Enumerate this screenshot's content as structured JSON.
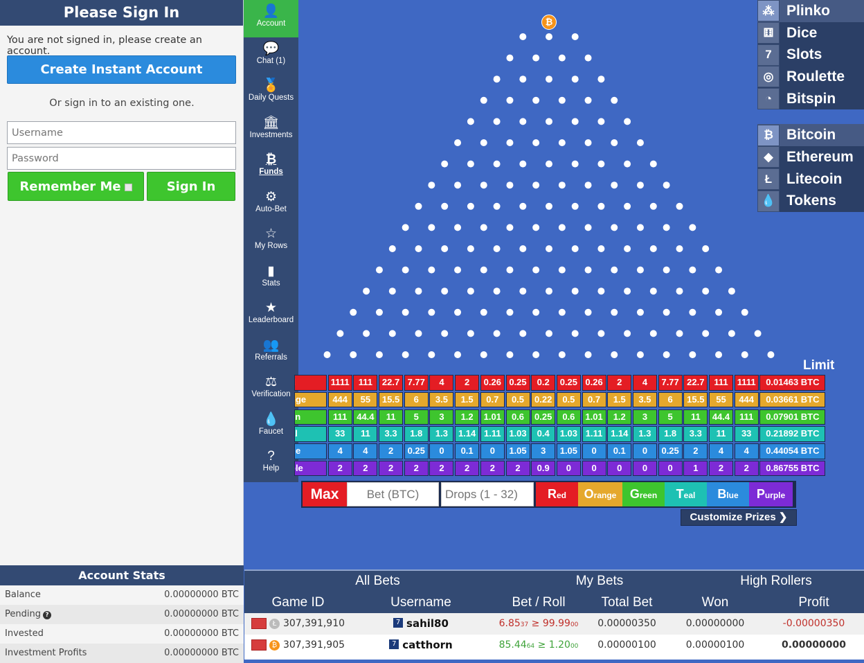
{
  "signin": {
    "title": "Please Sign In",
    "message": "You are not signed in, please create an account.",
    "create_button": "Create Instant Account",
    "or_text": "Or sign in to an existing one.",
    "username_placeholder": "Username",
    "password_placeholder": "Password",
    "remember_label": "Remember Me",
    "signin_button": "Sign In"
  },
  "account_stats": {
    "title": "Account Stats",
    "rows": [
      {
        "label": "Balance",
        "value": "0.00000000 BTC"
      },
      {
        "label": "Pending",
        "value": "0.00000000 BTC"
      },
      {
        "label": "Invested",
        "value": "0.00000000 BTC"
      },
      {
        "label": "Investment Profits",
        "value": "0.00000000 BTC"
      }
    ]
  },
  "nav": [
    {
      "label": "Account",
      "icon": "user-icon",
      "glyph": "👤"
    },
    {
      "label": "Chat (1)",
      "icon": "chat-icon",
      "glyph": "💬"
    },
    {
      "label": "Daily Quests",
      "icon": "award-icon",
      "glyph": "🏅"
    },
    {
      "label": "Investments",
      "icon": "bank-icon",
      "glyph": "🏛"
    },
    {
      "label": "Funds",
      "icon": "bitcoin-icon",
      "glyph": "₿"
    },
    {
      "label": "Auto-Bet",
      "icon": "gear-icon",
      "glyph": "⚙"
    },
    {
      "label": "My Rows",
      "icon": "star-outline-icon",
      "glyph": "☆"
    },
    {
      "label": "Stats",
      "icon": "bar-chart-icon",
      "glyph": "▮"
    },
    {
      "label": "Leaderboard",
      "icon": "star-icon",
      "glyph": "★"
    },
    {
      "label": "Referrals",
      "icon": "users-icon",
      "glyph": "👥"
    },
    {
      "label": "Verification",
      "icon": "scale-icon",
      "glyph": "⚖"
    },
    {
      "label": "Faucet",
      "icon": "droplet-icon",
      "glyph": "💧"
    },
    {
      "label": "Help",
      "icon": "question-icon",
      "glyph": "?"
    }
  ],
  "games": [
    {
      "label": "Plinko",
      "icon": "plinko-icon"
    },
    {
      "label": "Dice",
      "icon": "dice-icon"
    },
    {
      "label": "Slots",
      "icon": "slots-icon"
    },
    {
      "label": "Roulette",
      "icon": "roulette-icon"
    },
    {
      "label": "Bitspin",
      "icon": "bitspin-icon"
    }
  ],
  "currencies": [
    {
      "label": "Bitcoin",
      "icon": "bitcoin-icon"
    },
    {
      "label": "Ethereum",
      "icon": "ethereum-icon"
    },
    {
      "label": "Litecoin",
      "icon": "litecoin-icon"
    },
    {
      "label": "Tokens",
      "icon": "droplet-icon"
    }
  ],
  "limit_label": "Limit",
  "prize_rows": [
    {
      "label": "d",
      "color": "#e41d24",
      "cells": [
        "1111",
        "111",
        "22.7",
        "7.77",
        "4",
        "2",
        "0.26",
        "0.25",
        "0.2",
        "0.25",
        "0.26",
        "2",
        "4",
        "7.77",
        "22.7",
        "111",
        "1111"
      ],
      "limit": "0.01463 BTC"
    },
    {
      "label": "nge",
      "color": "#e5a82c",
      "cells": [
        "444",
        "55",
        "15.5",
        "6",
        "3.5",
        "1.5",
        "0.7",
        "0.5",
        "0.22",
        "0.5",
        "0.7",
        "1.5",
        "3.5",
        "6",
        "15.5",
        "55",
        "444"
      ],
      "limit": "0.03661 BTC"
    },
    {
      "label": "en",
      "color": "#3ec52e",
      "cells": [
        "111",
        "44.4",
        "11",
        "5",
        "3",
        "1.2",
        "1.01",
        "0.6",
        "0.25",
        "0.6",
        "1.01",
        "1.2",
        "3",
        "5",
        "11",
        "44.4",
        "111"
      ],
      "limit": "0.07901 BTC"
    },
    {
      "label": "al",
      "color": "#1ec1b3",
      "cells": [
        "33",
        "11",
        "3.3",
        "1.8",
        "1.3",
        "1.14",
        "1.11",
        "1.03",
        "0.4",
        "1.03",
        "1.11",
        "1.14",
        "1.3",
        "1.8",
        "3.3",
        "11",
        "33"
      ],
      "limit": "0.21892 BTC"
    },
    {
      "label": "ue",
      "color": "#2b8bdd",
      "cells": [
        "4",
        "4",
        "2",
        "0.25",
        "0",
        "0.1",
        "0",
        "1.05",
        "3",
        "1.05",
        "0",
        "0.1",
        "0",
        "0.25",
        "2",
        "4",
        "4"
      ],
      "limit": "0.44054 BTC"
    },
    {
      "label": "ple",
      "color": "#7d2bd6",
      "cells": [
        "2",
        "2",
        "2",
        "2",
        "2",
        "2",
        "2",
        "2",
        "0.9",
        "0",
        "0",
        "0",
        "0",
        "0",
        "1",
        "2",
        "2"
      ],
      "limit": "0.86755 BTC"
    }
  ],
  "betbar": {
    "max_label": "Max",
    "bet_placeholder": "Bet (BTC)",
    "drops_placeholder": "Drops (1 - 32)",
    "colors": [
      {
        "big": "R",
        "small": "ed",
        "color": "#e41d24"
      },
      {
        "big": "O",
        "small": "range",
        "color": "#e5a82c"
      },
      {
        "big": "G",
        "small": "reen",
        "color": "#3ec52e"
      },
      {
        "big": "T",
        "small": "eal",
        "color": "#1ec1b3"
      },
      {
        "big": "B",
        "small": "lue",
        "color": "#2b8bdd"
      },
      {
        "big": "P",
        "small": "urple",
        "color": "#7d2bd6"
      }
    ],
    "customize": "Customize Prizes ❯"
  },
  "bets": {
    "tabs": [
      "All Bets",
      "My Bets",
      "High Rollers"
    ],
    "headers": [
      "Game ID",
      "Username",
      "Bet / Roll",
      "Total Bet",
      "Won",
      "Profit"
    ],
    "rows": [
      {
        "coin": "litecoin-icon",
        "game_id": "307,391,910",
        "user": "sahil80",
        "level": "7",
        "roll_main": "6.85",
        "roll_sub": "37",
        "cmp": " ≥ 99.99",
        "cmp_sub": "00",
        "roll_color": "red",
        "total": "0.00000350",
        "won": "0.00000000",
        "profit": "-0.00000350",
        "profit_color": "red"
      },
      {
        "coin": "bitcoin-icon",
        "game_id": "307,391,905",
        "user": "catthorn",
        "level": "7",
        "roll_main": "85.44",
        "roll_sub": "64",
        "cmp": " ≥ 1.20",
        "cmp_sub": "00",
        "roll_color": "grn",
        "total": "0.00000100",
        "won": "0.00000100",
        "profit": "0.00000000",
        "profit_color": "none"
      }
    ]
  }
}
